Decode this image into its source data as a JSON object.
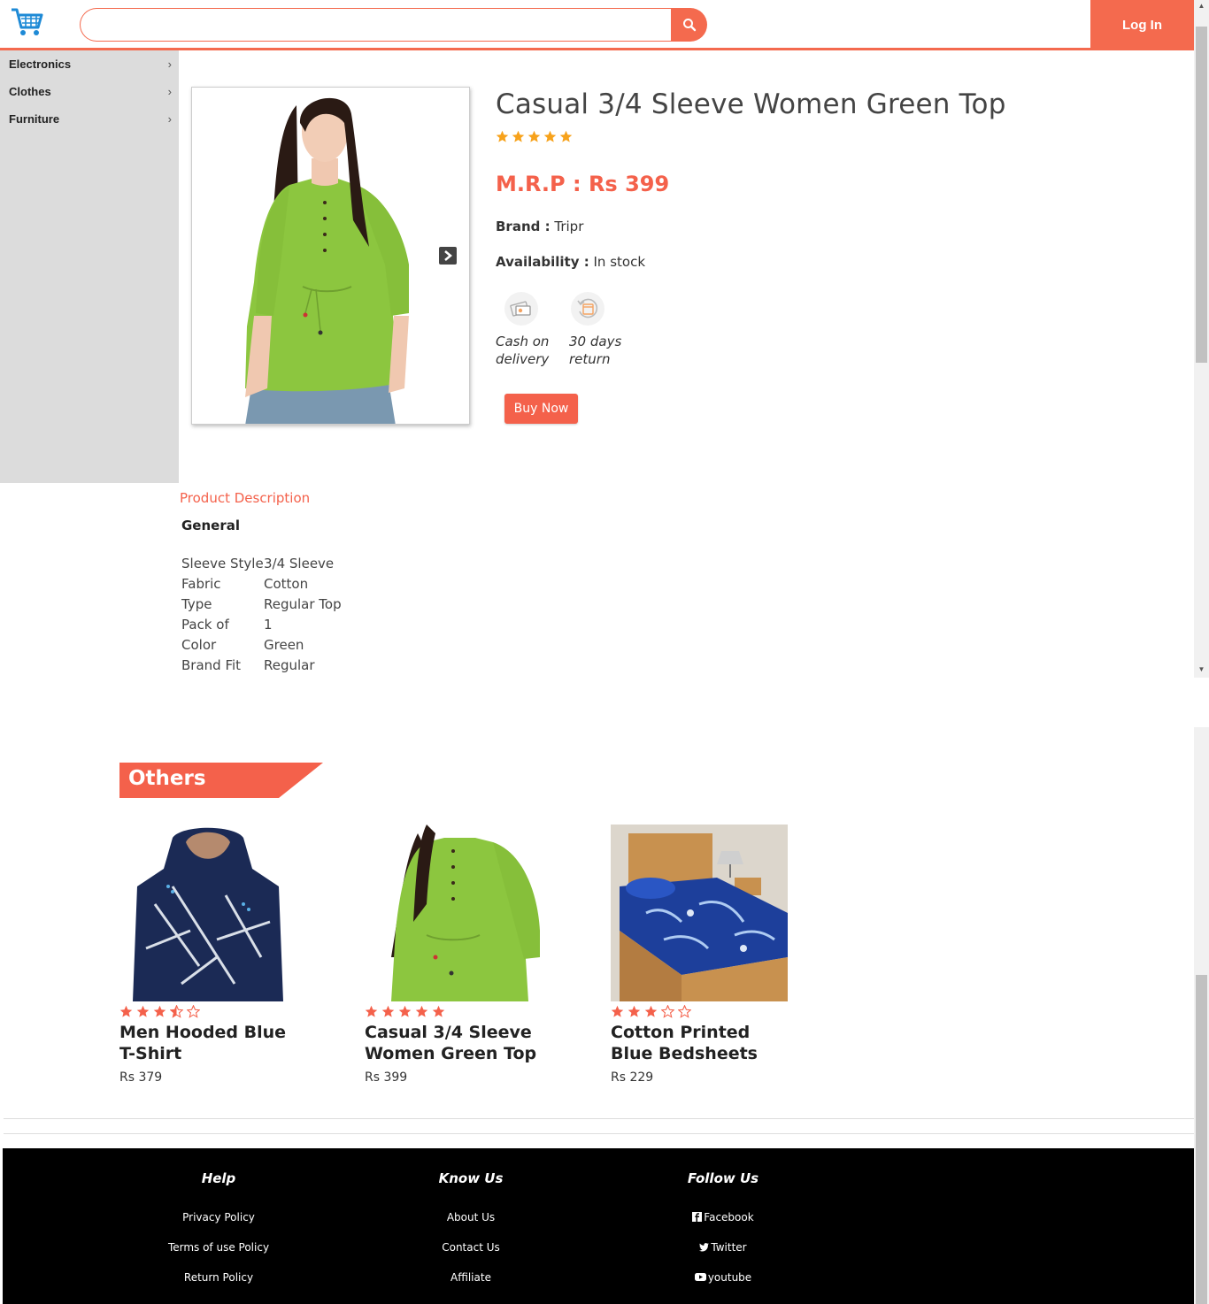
{
  "header": {
    "search_placeholder": "",
    "login_label": "Log In",
    "accent_color": "#f46a4e"
  },
  "sidebar": {
    "items": [
      {
        "label": "Electronics",
        "chevron": "›"
      },
      {
        "label": "Clothes",
        "chevron": "›"
      },
      {
        "label": "Furniture",
        "chevron": "›"
      }
    ]
  },
  "product": {
    "title": "Casual 3/4 Sleeve Women Green Top",
    "rating": 5,
    "price": "M.R.P : Rs 399",
    "brand_label": "Brand :",
    "brand_value": "Tripr",
    "availability_label": "Availability :",
    "availability_value": "In stock",
    "features": [
      {
        "icon": "cash-on-delivery-icon",
        "label_line1": "Cash on",
        "label_line2": "delivery"
      },
      {
        "icon": "return-icon",
        "label_line1": "30 days",
        "label_line2": "return"
      }
    ],
    "buy_label": "Buy Now"
  },
  "description": {
    "title": "Product Description",
    "section": "General",
    "specs": [
      {
        "key": "Sleeve Style",
        "value": "3/4 Sleeve"
      },
      {
        "key": "Fabric",
        "value": "Cotton"
      },
      {
        "key": "Type",
        "value": "Regular Top"
      },
      {
        "key": "Pack of",
        "value": "1"
      },
      {
        "key": "Color",
        "value": "Green"
      },
      {
        "key": "Brand Fit",
        "value": "Regular"
      }
    ]
  },
  "others": {
    "title": "Others",
    "products": [
      {
        "title": "Men Hooded Blue T-Shirt",
        "price": "Rs 379",
        "rating": 3.5
      },
      {
        "title": "Casual 3/4 Sleeve Women Green Top",
        "price": "Rs 399",
        "rating": 5
      },
      {
        "title": "Cotton Printed Blue Bedsheets",
        "price": "Rs 229",
        "rating": 3
      }
    ]
  },
  "footer": {
    "columns": [
      {
        "title": "Help",
        "links": [
          "Privacy Policy",
          "Terms of use Policy",
          "Return Policy"
        ]
      },
      {
        "title": "Know Us",
        "links": [
          "About Us",
          "Contact Us",
          "Affiliate"
        ]
      },
      {
        "title": "Follow Us",
        "links": [
          "Facebook",
          "Twitter",
          "youtube"
        ]
      }
    ]
  }
}
